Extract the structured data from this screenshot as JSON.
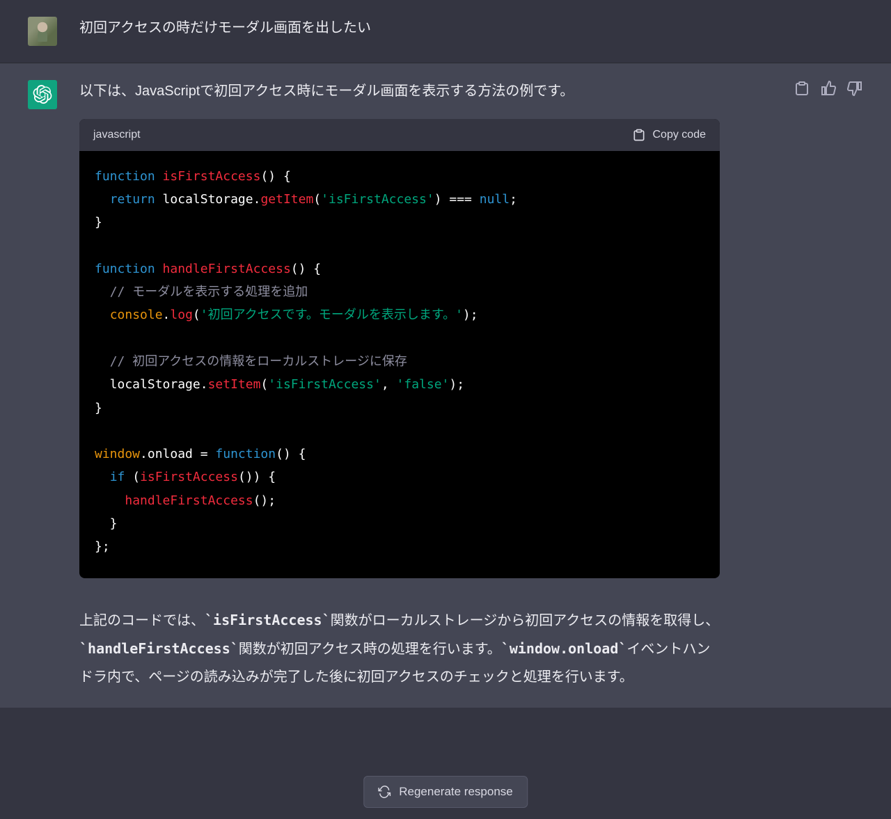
{
  "user": {
    "message": "初回アクセスの時だけモーダル画面を出したい"
  },
  "assistant": {
    "intro": "以下は、JavaScriptで初回アクセス時にモーダル画面を表示する方法の例です。",
    "code": {
      "language": "javascript",
      "copy_label": "Copy code",
      "tokens": [
        [
          [
            "kw",
            "function"
          ],
          [
            "def",
            " "
          ],
          [
            "fn",
            "isFirstAccess"
          ],
          [
            "def",
            "() {"
          ]
        ],
        [
          [
            "def",
            "  "
          ],
          [
            "kw",
            "return"
          ],
          [
            "def",
            " localStorage."
          ],
          [
            "fn",
            "getItem"
          ],
          [
            "def",
            "("
          ],
          [
            "str",
            "'isFirstAccess'"
          ],
          [
            "def",
            ") === "
          ],
          [
            "null",
            "null"
          ],
          [
            "def",
            ";"
          ]
        ],
        [
          [
            "def",
            "}"
          ]
        ],
        [],
        [
          [
            "kw",
            "function"
          ],
          [
            "def",
            " "
          ],
          [
            "fn",
            "handleFirstAccess"
          ],
          [
            "def",
            "() {"
          ]
        ],
        [
          [
            "def",
            "  "
          ],
          [
            "cmt",
            "// モーダルを表示する処理を追加"
          ]
        ],
        [
          [
            "def",
            "  "
          ],
          [
            "prop",
            "console"
          ],
          [
            "def",
            "."
          ],
          [
            "fn",
            "log"
          ],
          [
            "def",
            "("
          ],
          [
            "str",
            "'初回アクセスです。モーダルを表示します。'"
          ],
          [
            "def",
            ");"
          ]
        ],
        [],
        [
          [
            "def",
            "  "
          ],
          [
            "cmt",
            "// 初回アクセスの情報をローカルストレージに保存"
          ]
        ],
        [
          [
            "def",
            "  localStorage."
          ],
          [
            "fn",
            "setItem"
          ],
          [
            "def",
            "("
          ],
          [
            "str",
            "'isFirstAccess'"
          ],
          [
            "def",
            ", "
          ],
          [
            "str",
            "'false'"
          ],
          [
            "def",
            ");"
          ]
        ],
        [
          [
            "def",
            "}"
          ]
        ],
        [],
        [
          [
            "prop",
            "window"
          ],
          [
            "def",
            ".onload = "
          ],
          [
            "kw",
            "function"
          ],
          [
            "def",
            "() {"
          ]
        ],
        [
          [
            "def",
            "  "
          ],
          [
            "kw",
            "if"
          ],
          [
            "def",
            " ("
          ],
          [
            "fn",
            "isFirstAccess"
          ],
          [
            "def",
            "()) {"
          ]
        ],
        [
          [
            "def",
            "    "
          ],
          [
            "fn",
            "handleFirstAccess"
          ],
          [
            "def",
            "();"
          ]
        ],
        [
          [
            "def",
            "  }"
          ]
        ],
        [
          [
            "def",
            "};"
          ]
        ]
      ]
    },
    "explanation": {
      "pre1": "上記のコードでは、",
      "c1": "`isFirstAccess`",
      "mid1": "関数がローカルストレージから初回アクセスの情報を取得し、",
      "c2": "`handleFirstAccess`",
      "mid2": "関数が初回アクセス時の処理を行います。",
      "c3": "`window.onload`",
      "mid3": "イベントハンドラ内で、ページの読み込みが完了した後に初回アクセスのチェックと処理を行います。"
    }
  },
  "footer": {
    "regenerate_label": "Regenerate response"
  }
}
